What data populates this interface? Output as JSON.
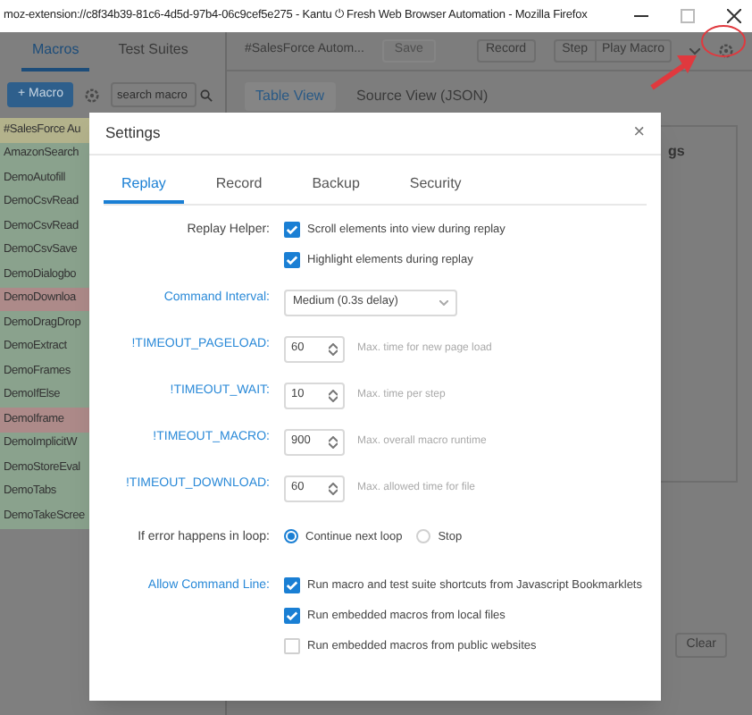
{
  "window": {
    "title": "moz-extension://c8f34b39-81c6-4d5d-97b4-06c9cef5e275 - Kantu ⏻ Fresh Web Browser Automation - Mozilla Firefox"
  },
  "sidebar": {
    "tabs": [
      {
        "label": "Macros",
        "selected": true
      },
      {
        "label": "Test Suites",
        "selected": false
      }
    ],
    "new_button": "+ Macro",
    "search": {
      "placeholder": "search macro"
    },
    "macros": [
      {
        "label": "#SalesForce Au",
        "color": "#b3b28b"
      },
      {
        "label": "AmazonSearch",
        "color": "#8aa28d"
      },
      {
        "label": "DemoAutofill",
        "color": "#8aa28d"
      },
      {
        "label": "DemoCsvRead",
        "color": "#8aa28d"
      },
      {
        "label": "DemoCsvRead",
        "color": "#8aa28d"
      },
      {
        "label": "DemoCsvSave",
        "color": "#8aa28d"
      },
      {
        "label": "DemoDialogbo",
        "color": "#8aa28d"
      },
      {
        "label": "DemoDownloa",
        "color": "#ad8a89"
      },
      {
        "label": "DemoDragDrop",
        "color": "#8aa28d"
      },
      {
        "label": "DemoExtract",
        "color": "#8aa28d"
      },
      {
        "label": "DemoFrames",
        "color": "#8aa28d"
      },
      {
        "label": "DemoIfElse",
        "color": "#8aa28d"
      },
      {
        "label": "DemoIframe",
        "color": "#ad8a89"
      },
      {
        "label": "DemoImplicitW",
        "color": "#8aa28d"
      },
      {
        "label": "DemoStoreEval",
        "color": "#8aa28d"
      },
      {
        "label": "DemoTabs",
        "color": "#8aa28d"
      },
      {
        "label": "DemoTakeScree",
        "color": "#8aa28d"
      }
    ]
  },
  "toolbar": {
    "macro_name": "#SalesForce Autom...",
    "save": "Save",
    "record": "Record",
    "step": "Step",
    "play": "Play Macro"
  },
  "view_tabs": [
    {
      "label": "Table View",
      "selected": true
    },
    {
      "label": "Source View (JSON)",
      "selected": false
    }
  ],
  "panel": {
    "heading": "gs",
    "clear": "Clear"
  },
  "dialog": {
    "title": "Settings",
    "close": "×",
    "tabs": [
      {
        "label": "Replay",
        "selected": true
      },
      {
        "label": "Record",
        "selected": false
      },
      {
        "label": "Backup",
        "selected": false
      },
      {
        "label": "Security",
        "selected": false
      }
    ],
    "rows": [
      {
        "kind": "checks",
        "label": "Replay Helper:",
        "highlighted": false,
        "options": [
          {
            "label": "Scroll elements into view during replay",
            "checked": true
          },
          {
            "label": "Highlight elements during replay",
            "checked": true
          }
        ]
      },
      {
        "kind": "select",
        "label": "Command Interval:",
        "highlighted": true,
        "value": "Medium (0.3s delay)"
      },
      {
        "kind": "number",
        "label": "!TIMEOUT_PAGELOAD:",
        "highlighted": true,
        "value": "60",
        "hint": "Max. time for new page load"
      },
      {
        "kind": "number",
        "label": "!TIMEOUT_WAIT:",
        "highlighted": true,
        "value": "10",
        "hint": "Max. time per step"
      },
      {
        "kind": "number",
        "label": "!TIMEOUT_MACRO:",
        "highlighted": true,
        "value": "900",
        "hint": "Max. overall macro runtime"
      },
      {
        "kind": "number",
        "label": "!TIMEOUT_DOWNLOAD:",
        "highlighted": true,
        "value": "60",
        "hint": "Max. allowed time for file"
      },
      {
        "kind": "radios",
        "label": "If error happens in loop:",
        "highlighted": false,
        "options": [
          {
            "label": "Continue next loop",
            "selected": true
          },
          {
            "label": "Stop",
            "selected": false
          }
        ]
      },
      {
        "kind": "checks",
        "label": "Allow Command Line:",
        "highlighted": true,
        "options": [
          {
            "label": "Run macro and test suite shortcuts from Javascript Bookmarklets",
            "checked": true
          },
          {
            "label": "Run embedded macros from local files",
            "checked": true
          },
          {
            "label": "Run embedded macros from public websites",
            "checked": false
          }
        ]
      }
    ]
  }
}
